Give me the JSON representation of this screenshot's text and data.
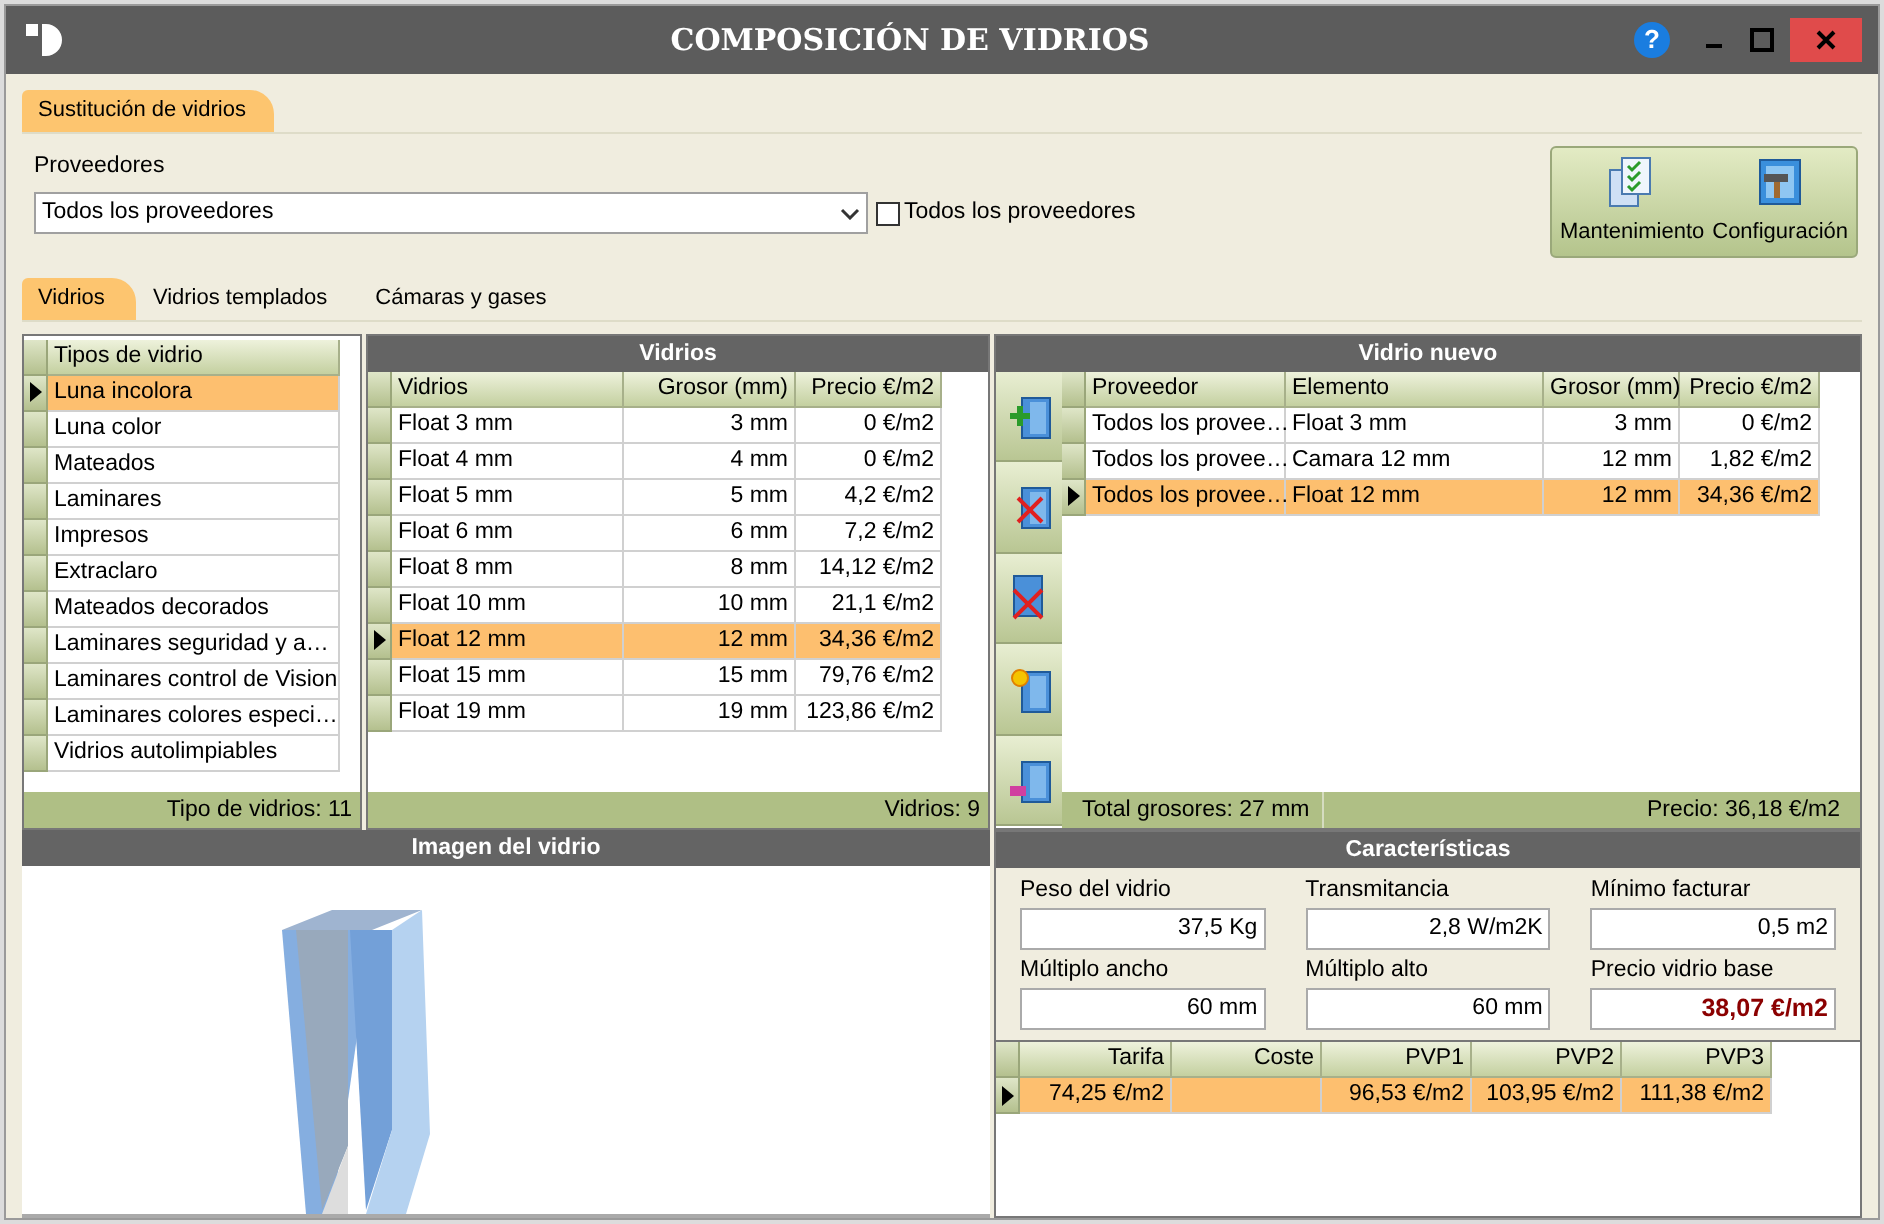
{
  "window": {
    "title": "COMPOSICIÓN DE VIDRIOS",
    "help": "?"
  },
  "top_tabs": [
    {
      "label": "Sustitución de vidrios",
      "selected": true
    }
  ],
  "proveedores": {
    "label": "Proveedores",
    "value": "Todos los proveedores",
    "checkbox": {
      "label": "Todos los proveedores",
      "checked": false
    }
  },
  "actions": [
    "Mantenimiento",
    "Configuración"
  ],
  "tabs": [
    {
      "label": "Vidrios",
      "selected": true
    },
    {
      "label": "Vidrios templados",
      "selected": false
    },
    {
      "label": "Cámaras y gases",
      "selected": false
    }
  ],
  "tipos": {
    "columns": [
      "Tipos de vidrio"
    ],
    "rows": [
      {
        "cells": [
          "Luna incolora"
        ],
        "selected": true
      },
      {
        "cells": [
          "Luna color"
        ],
        "selected": false
      },
      {
        "cells": [
          "Mateados"
        ],
        "selected": false
      },
      {
        "cells": [
          "Laminares"
        ],
        "selected": false
      },
      {
        "cells": [
          "Impresos"
        ],
        "selected": false
      },
      {
        "cells": [
          "Extraclaro"
        ],
        "selected": false
      },
      {
        "cells": [
          "Mateados decorados"
        ],
        "selected": false
      },
      {
        "cells": [
          "Laminares seguridad y a…"
        ],
        "selected": false
      },
      {
        "cells": [
          "Laminares control de Vision"
        ],
        "selected": false
      },
      {
        "cells": [
          "Laminares colores especi…"
        ],
        "selected": false
      },
      {
        "cells": [
          "Vidrios autolimpiables"
        ],
        "selected": false
      }
    ],
    "footer": "Tipo de vidrios: 11"
  },
  "vidrios": {
    "title": "Vidrios",
    "columns": [
      "Vidrios",
      "Grosor (mm)",
      "Precio €/m2"
    ],
    "rows": [
      {
        "cells": [
          "Float 3 mm",
          "3 mm",
          "0 €/m2"
        ],
        "selected": false
      },
      {
        "cells": [
          "Float 4 mm",
          "4 mm",
          "0 €/m2"
        ],
        "selected": false
      },
      {
        "cells": [
          "Float 5 mm",
          "5 mm",
          "4,2 €/m2"
        ],
        "selected": false
      },
      {
        "cells": [
          "Float 6 mm",
          "6 mm",
          "7,2 €/m2"
        ],
        "selected": false
      },
      {
        "cells": [
          "Float 8 mm",
          "8 mm",
          "14,12 €/m2"
        ],
        "selected": false
      },
      {
        "cells": [
          "Float 10 mm",
          "10 mm",
          "21,1 €/m2"
        ],
        "selected": false
      },
      {
        "cells": [
          "Float 12 mm",
          "12 mm",
          "34,36 €/m2"
        ],
        "selected": true
      },
      {
        "cells": [
          "Float 15 mm",
          "15 mm",
          "79,76 €/m2"
        ],
        "selected": false
      },
      {
        "cells": [
          "Float 19 mm",
          "19 mm",
          "123,86 €/m2"
        ],
        "selected": false
      }
    ],
    "footer": "Vidrios: 9"
  },
  "vidrio_nuevo": {
    "title": "Vidrio nuevo",
    "columns": [
      "Proveedor",
      "Elemento",
      "Grosor (mm)",
      "Precio €/m2"
    ],
    "rows": [
      {
        "cells": [
          "Todos los provee…",
          "Float 3 mm",
          "3 mm",
          "0 €/m2"
        ],
        "selected": false
      },
      {
        "cells": [
          "Todos los provee…",
          "Camara 12 mm",
          "12 mm",
          "1,82 €/m2"
        ],
        "selected": false
      },
      {
        "cells": [
          "Todos los provee…",
          "Float 12 mm",
          "12 mm",
          "34,36 €/m2"
        ],
        "selected": true
      }
    ],
    "footer_left": "Total grosores: 27 mm",
    "footer_right": "Precio: 36,18 €/m2"
  },
  "imagen": {
    "title": "Imagen del vidrio"
  },
  "caracteristicas": {
    "title": "Características",
    "fields": [
      {
        "label": "Peso del vidrio",
        "value": "37,5 Kg",
        "emphasized": false
      },
      {
        "label": "Transmitancia",
        "value": "2,8 W/m2K",
        "emphasized": false
      },
      {
        "label": "Mínimo facturar",
        "value": "0,5 m2",
        "emphasized": false
      },
      {
        "label": "Múltiplo ancho",
        "value": "60 mm",
        "emphasized": false
      },
      {
        "label": "Múltiplo alto",
        "value": "60 mm",
        "emphasized": false
      },
      {
        "label": "Precio vidrio base",
        "value": "38,07 €/m2",
        "emphasized": true
      }
    ],
    "tarifas": {
      "columns": [
        "Tarifa",
        "Coste",
        "PVP1",
        "PVP2",
        "PVP3"
      ],
      "rows": [
        {
          "cells": [
            "74,25 €/m2",
            "",
            "96,53 €/m2",
            "103,95 €/m2",
            "111,38 €/m2"
          ],
          "selected": true
        }
      ]
    }
  }
}
